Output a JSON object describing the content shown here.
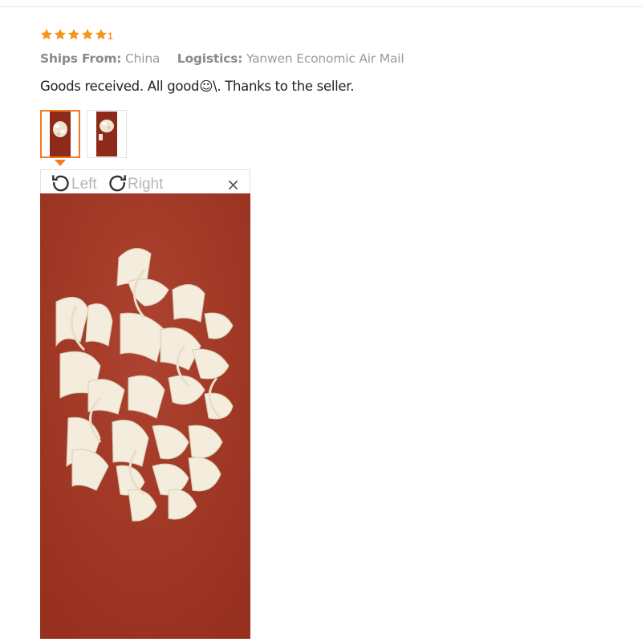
{
  "review": {
    "rating": 5,
    "rating_suffix": "1",
    "ships_from_label": "Ships From:",
    "ships_from_value": "China",
    "logistics_label": "Logistics:",
    "logistics_value": "Yanwen Economic Air Mail",
    "text": "Goods received. All good☺\\. Thanks to the seller.",
    "star_color": "#f7941d"
  },
  "thumbnails": {
    "count": 2,
    "active_index": 0,
    "active_color": "#f47a1f"
  },
  "viewer": {
    "rotate_left_label": "Left",
    "rotate_right_label": "Right",
    "close_label": "×",
    "background_color": "#a33a26"
  }
}
